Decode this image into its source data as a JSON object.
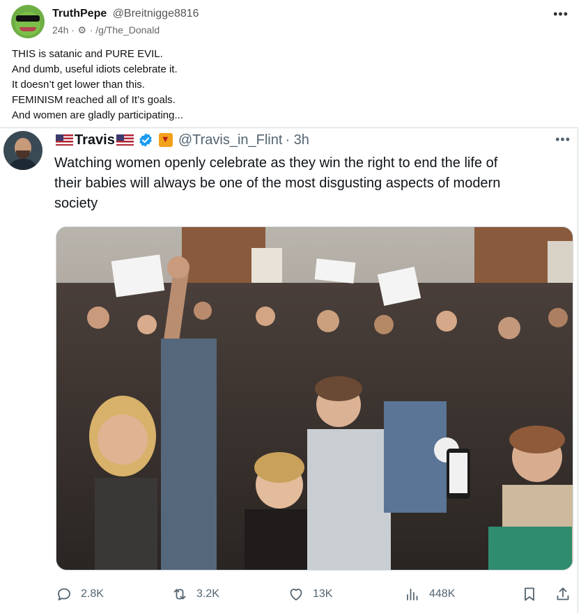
{
  "post": {
    "author_name": "TruthPepe",
    "author_handle": "@Breitnigge8816",
    "age": "24h",
    "community": "/g/The_Donald",
    "more_icon": "more-icon",
    "body_lines": [
      "THIS is satanic and PURE EVIL.",
      "And dumb, useful idiots celebrate it.",
      "It doesn’t get lower than this.",
      "FEMINISM reached all of It’s goals.",
      "And women are gladly participating..."
    ]
  },
  "quoted_tweet": {
    "name": "Travis",
    "handle": "@Travis_in_Flint",
    "time": "· 3h",
    "text_lines": [
      "Watching women openly celebrate as they win the right to end the life of",
      "their babies will always be one of the most disgusting aspects of modern",
      "society"
    ],
    "actions": {
      "replies": "2.8K",
      "reposts": "3.2K",
      "likes": "13K",
      "views": "448K"
    }
  },
  "colors": {
    "verified_blue": "#1d9bf0",
    "muted": "#536471",
    "border": "#cfd9de"
  }
}
